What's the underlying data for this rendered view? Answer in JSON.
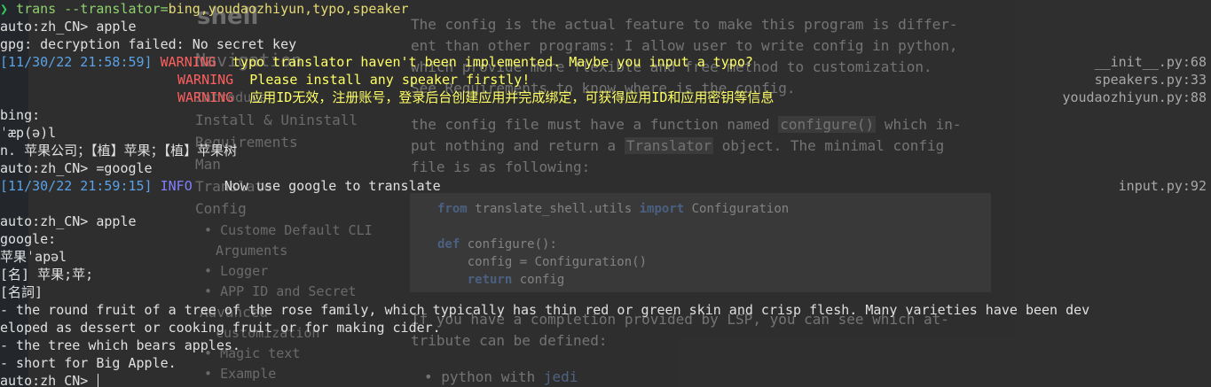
{
  "background_doc": {
    "heading": "shell",
    "sidebar": [
      "Navigation",
      "Introduce",
      "Install & Uninstall",
      "Requirements",
      "Man",
      "Translate",
      "Config",
      "Custome Default CLI",
      "Arguments",
      "Logger",
      "APP ID and Secret",
      "Advanced",
      "customization",
      "Magic text",
      "Example"
    ],
    "paragraphs": [
      "The config is the actual feature to make this program is differ-",
      "ent than other programs: I allow user to write config in python,",
      "which provide more flexible and free method to customization.",
      "See Requirements to know where is the config."
    ],
    "para2_parts": [
      "the config file must have a function named ",
      "configure()",
      " which in-"
    ],
    "para2_line2_parts": [
      "put nothing and return a ",
      "Translator",
      " object. The minimal config"
    ],
    "para2_line3": "file is as following:",
    "code": {
      "l1_kw": "from",
      "l1_mid": " translate_shell.utils ",
      "l1_kw2": "import",
      "l1_end": " Configuration",
      "l2_kw": "def",
      "l2_end": " configure():",
      "l3": "    config = Configuration()",
      "l4_kw": "    return",
      "l4_end": " config"
    },
    "para3_l1": "If you have a completion provided by LSP, you can see which at-",
    "para3_l2": "tribute can be defined:",
    "list_item_pre": "python with ",
    "list_item_link": "jedi"
  },
  "terminal": {
    "prompt_arrow": "❯",
    "cmd_name": "trans",
    "cmd_args": " --translator=",
    "cmd_value": "bing,youdaozhiyun,typo,speaker",
    "prompt": "auto:zh_CN> ",
    "in1": "apple",
    "gpg": "gpg: decryption failed: No secret key",
    "log1": {
      "time": "[11/30/22 21:58:59]",
      "level": "WARNING",
      "msg": "  typo translator haven't been implemented. Maybe you input a typo?",
      "src": "__init__.py:68"
    },
    "log2": {
      "level": "WARNING",
      "msg": "  Please install any speaker firstly!",
      "src": "speakers.py:33"
    },
    "log3": {
      "level": "WARNING",
      "msg": "  应用ID无效，注册账号，登录后台创建应用并完成绑定，可获得应用ID和应用密钥等信息",
      "src": "youdaozhiyun.py:88"
    },
    "bing_label": "bing:",
    "bing_phon": "ˈæp(ə)l",
    "bing_def": "n. 苹果公司；【植】苹果；【植】苹果树",
    "in2": "=google",
    "log4": {
      "time": "[11/30/22 21:59:15]",
      "level": "INFO",
      "msg": "    Now use google to translate",
      "src": "input.py:92"
    },
    "in3": "apple",
    "google_label": "google:",
    "google_word": "苹果",
    "google_phon": "ˈapəl",
    "noun1": "[名] 苹果;苹;",
    "noun2": "[名詞]",
    "def1a": "- the round fruit of a tree of the rose family, which typically has thin red or green skin and crisp flesh. Many varieties have been dev",
    "def1b": "eloped as dessert or cooking fruit or for making cider.",
    "def2": "- the tree which bears apples.",
    "def3": "- short for Big Apple."
  },
  "colors": {
    "terminal_bg": "#262626",
    "warning": "#ff5f5f",
    "info": "#8080ff",
    "timestamp": "#5aa2e6",
    "command": "#8fd16e"
  }
}
